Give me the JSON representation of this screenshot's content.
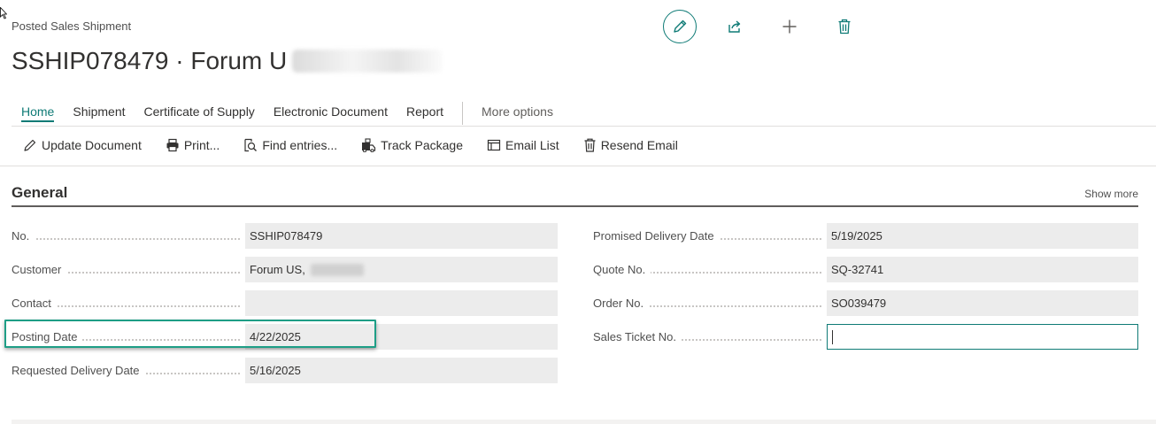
{
  "header": {
    "caption": "Posted Sales Shipment",
    "title": "SSHIP078479 · Forum U"
  },
  "actions": [
    {
      "name": "edit-button",
      "icon": "pencil-icon"
    },
    {
      "name": "share-button",
      "icon": "share-icon"
    },
    {
      "name": "new-button",
      "icon": "plus-icon"
    },
    {
      "name": "delete-button",
      "icon": "trash-icon"
    }
  ],
  "tabs": {
    "home": "Home",
    "shipment": "Shipment",
    "certificate": "Certificate of Supply",
    "electronic": "Electronic Document",
    "report": "Report",
    "more": "More options"
  },
  "toolbar": {
    "update_document": "Update Document",
    "print": "Print...",
    "find_entries": "Find entries...",
    "track_package": "Track Package",
    "email_list": "Email List",
    "resend_email": "Resend Email"
  },
  "general": {
    "title": "General",
    "show_more": "Show more",
    "left": {
      "no": {
        "label": "No.",
        "value": "SSHIP078479"
      },
      "customer": {
        "label": "Customer",
        "value": "Forum US,"
      },
      "contact": {
        "label": "Contact",
        "value": ""
      },
      "posting_date": {
        "label": "Posting Date",
        "value": "4/22/2025"
      },
      "requested_delivery_date": {
        "label": "Requested Delivery Date",
        "value": "5/16/2025"
      }
    },
    "right": {
      "promised_delivery_date": {
        "label": "Promised Delivery Date",
        "value": "5/19/2025"
      },
      "quote_no": {
        "label": "Quote No.",
        "value": "SQ-32741"
      },
      "order_no": {
        "label": "Order No.",
        "value": "SO039479"
      },
      "sales_ticket_no": {
        "label": "Sales Ticket No.",
        "value": ""
      }
    }
  },
  "colors": {
    "accent": "#0f7b76",
    "highlight": "#1e9e86",
    "field_bg": "#ececec"
  }
}
